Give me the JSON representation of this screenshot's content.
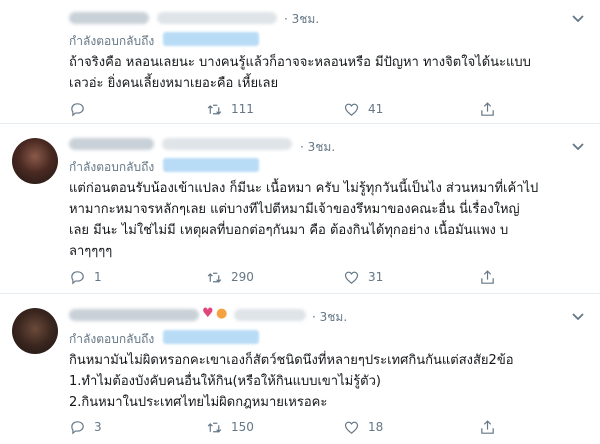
{
  "tweets": [
    {
      "time": "· 3ชม.",
      "reply_label": "กำลังตอบกลับถึง",
      "lines": [
        "ถ้าจริงคือ หลอนเลยนะ บางคนรู้แล้วก็อาจจะหลอนหรือ มีปัญหา ทางจิตใจได้นะแบบ",
        "เลวอ่ะ ยิ่งคนเลี้ยงหมาเยอะคือ เหี้ยเลย"
      ],
      "reply_count": "",
      "retweet_count": "111",
      "like_count": "41"
    },
    {
      "time": "· 3ชม.",
      "reply_label": "กำลังตอบกลับถึง",
      "lines": [
        "แต่ก่อนตอนรับน้องเข้าแปลง ก็มีนะ เนื้อหมา ครับ ไม่รู้ทุกวันนี้เป็นไง ส่วนหมาที่เค้าไป",
        "หามากะหมาจรหลักๆเลย แต่บางทีไปตีหมามีเจ้าของรึหมาของคณะอื่น นี่เรื่องใหญ่",
        "เลย มีนะ ไม่ใช่ไม่มี เหตุผลที่บอกต่อๆกันมา คือ ต้องกินได้ทุกอย่าง เนื้อมันแพง บ",
        "ลาๆๆๆๆ"
      ],
      "reply_count": "1",
      "retweet_count": "290",
      "like_count": "31"
    },
    {
      "time": "· 3ชม.",
      "reply_label": "กำลังตอบกลับถึง",
      "lines": [
        "กินหมามันไม่ผิดหรอกคะเขาเองก็สัตว์ชนิดนึงที่หลายๆประเทศกินกันแต่สงสัย2ข้อ",
        "1.ทำไมต้องบังคับคนอื่นให้กิน(หรือให้กินแบบเขาไม่รู้ตัว)",
        "2.กินหมาในประเทศไทยไม่ผิดกฎหมายเหรอคะ"
      ],
      "reply_count": "3",
      "retweet_count": "150",
      "like_count": "18"
    }
  ],
  "icons": {
    "reply": "reply-icon",
    "retweet": "retweet-icon",
    "like": "heart-icon",
    "share": "share-icon",
    "menu": "chevron-down-icon"
  },
  "colors": {
    "meta": "#657786",
    "text": "#14171a",
    "divider": "#e6ecf0"
  }
}
